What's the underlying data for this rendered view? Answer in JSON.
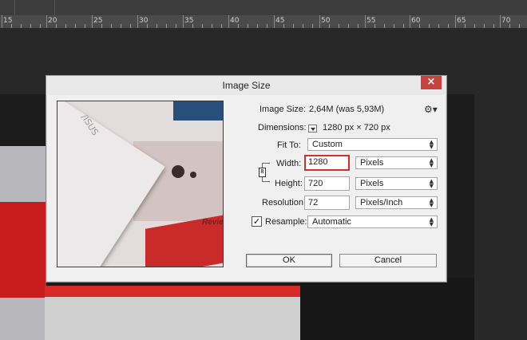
{
  "ruler": {
    "labels": [
      "15",
      "20",
      "25",
      "30",
      "35",
      "40",
      "45",
      "50",
      "55",
      "60",
      "65",
      "70"
    ]
  },
  "dialog": {
    "title": "Image Size",
    "close_symbol": "×",
    "preview": {
      "logo_text": "/ISUS",
      "side_text": "Revie"
    },
    "image_size": {
      "label": "Image Size:",
      "value": "2,64M (was 5,93M)"
    },
    "settings_icon": "gear-icon",
    "dimensions": {
      "label": "Dimensions:",
      "value": "1280 px  ×  720 px"
    },
    "fit_to": {
      "label": "Fit To:",
      "value": "Custom"
    },
    "width": {
      "label": "Width:",
      "value": "1280",
      "unit": "Pixels"
    },
    "height": {
      "label": "Height:",
      "value": "720",
      "unit": "Pixels"
    },
    "resolution": {
      "label": "Resolution:",
      "value": "72",
      "unit": "Pixels/Inch"
    },
    "resample": {
      "label": "Resample:",
      "checked": true,
      "check_symbol": "✓",
      "value": "Automatic"
    },
    "link_symbol": "8",
    "ok_label": "OK",
    "cancel_label": "Cancel"
  },
  "colors": {
    "close_button": "#c7423d",
    "active_field_border": "#d32f2f"
  }
}
